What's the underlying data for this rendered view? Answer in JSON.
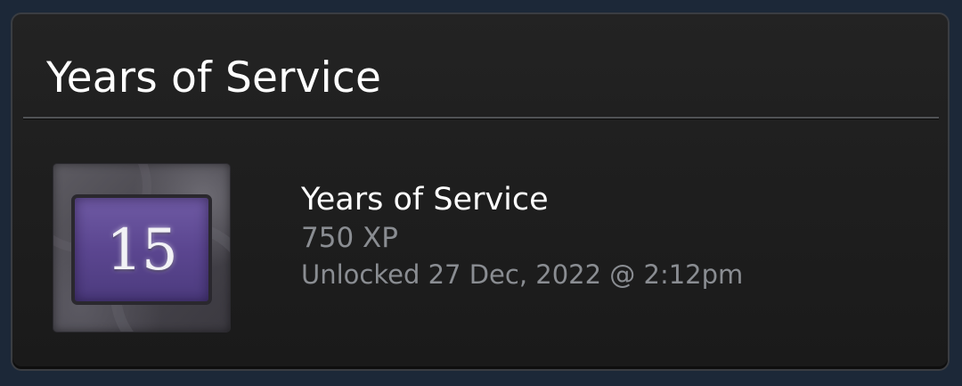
{
  "panel": {
    "title": "Years of Service"
  },
  "badge": {
    "number": "15",
    "icon": "years-of-service-badge"
  },
  "details": {
    "name": "Years of Service",
    "xp": "750 XP",
    "unlocked": "Unlocked 27 Dec, 2022 @ 2:12pm"
  },
  "colors": {
    "background": "#1c2838",
    "panel": "#1f1f1f",
    "badge_screen": "#5b4690",
    "muted_text": "#8a8d92"
  }
}
